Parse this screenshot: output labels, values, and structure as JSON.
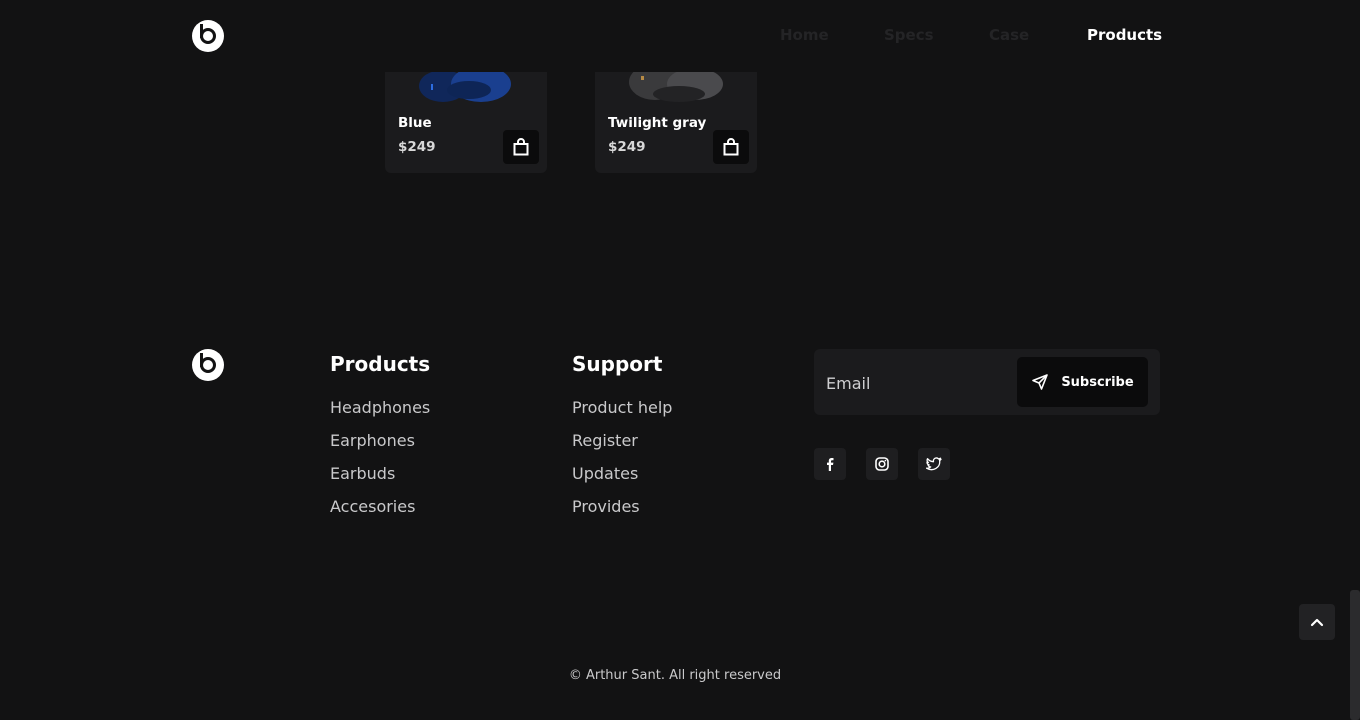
{
  "header": {
    "nav": [
      {
        "label": "Home"
      },
      {
        "label": "Specs"
      },
      {
        "label": "Case"
      },
      {
        "label": "Products"
      }
    ],
    "active_nav": "Products"
  },
  "products": [
    {
      "name": "Blue",
      "price": "$249",
      "color": "#1f4fb3"
    },
    {
      "name": "Twilight gray",
      "price": "$249",
      "color": "#3a3a3c"
    }
  ],
  "footer": {
    "columns": [
      {
        "title": "Products",
        "links": [
          "Headphones",
          "Earphones",
          "Earbuds",
          "Accesories"
        ]
      },
      {
        "title": "Support",
        "links": [
          "Product help",
          "Register",
          "Updates",
          "Provides"
        ]
      }
    ],
    "email_placeholder": "Email",
    "subscribe_label": "Subscribe",
    "social": [
      "facebook-icon",
      "instagram-icon",
      "twitter-icon"
    ],
    "copyright": "© Arthur Sant. All right reserved"
  },
  "colors": {
    "background": "#121213",
    "card": "#1b1b1d",
    "nav_inactive": "#242426"
  }
}
